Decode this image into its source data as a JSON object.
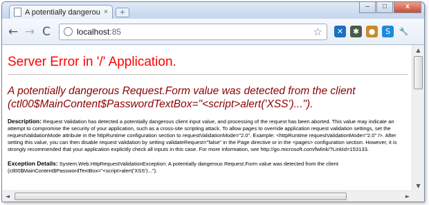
{
  "tab": {
    "title": "A potentially dangerous ...",
    "close": "×",
    "new_tab": "+"
  },
  "window_controls": {
    "minimize": "–",
    "maximize": "□",
    "close": "x"
  },
  "toolbar": {
    "back": "←",
    "forward": "→",
    "reload": "C",
    "address_host": "localhost",
    "address_port": ":85",
    "bookmark_star": "☆",
    "extensions": [
      {
        "name": "x-extension-icon",
        "glyph": "✕",
        "color": "#1d6fbf"
      },
      {
        "name": "bug-extension-icon",
        "glyph": "✱",
        "color": "#4a5a4a"
      },
      {
        "name": "cookie-extension-icon",
        "glyph": "●",
        "color": "#c98a2e"
      },
      {
        "name": "s-extension-icon",
        "glyph": "S",
        "color": "#1f8ad6"
      },
      {
        "name": "wrench-menu-icon",
        "glyph": "🔧",
        "color": "#6b7a8e"
      }
    ]
  },
  "page": {
    "heading": "Server Error in '/' Application.",
    "error_title": "A potentially dangerous Request.Form value was detected from the client (ctl00$MainContent$PasswordTextBox=\"<script>alert('XSS')...\").",
    "description_label": "Description:",
    "description_text": "Request Validation has detected a potentially dangerous client input value, and processing of the request has been aborted. This value may indicate an attempt to compromise the security of your application, such as a cross-site scripting attack. To allow pages to override application request validation settings, set the requestValidationMode attribute in the httpRuntime configuration section to requestValidationMode=\"2.0\". Example: <httpRuntime requestValidationMode=\"2.0\" />. After setting this value, you can then disable request validation by setting validateRequest=\"false\" in the Page directive or in the <pages> configuration section. However, it is strongly recommended that your application explicitly check all inputs in this case. For more information, see http://go.microsoft.com/fwlink/?LinkId=153133.",
    "exception_label": "Exception Details:",
    "exception_text": "System.Web.HttpRequestValidationException: A potentially dangerous Request.Form value was detected from the client (ctl00$MainContent$PasswordTextBox=\"<script>alert('XSS')...\")."
  },
  "scrollbars": {
    "up": "▲",
    "down": "▼",
    "left": "◄",
    "right": "►"
  }
}
